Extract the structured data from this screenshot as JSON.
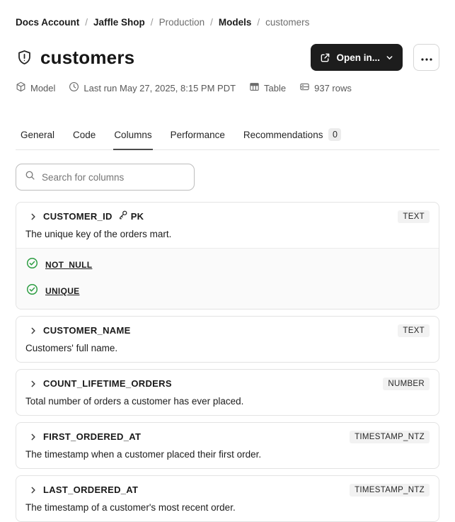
{
  "breadcrumb": {
    "separator": "/",
    "items": [
      {
        "label": "Docs Account",
        "emphasis": true
      },
      {
        "label": "Jaffle Shop",
        "emphasis": true
      },
      {
        "label": "Production",
        "emphasis": false
      },
      {
        "label": "Models",
        "emphasis": true
      },
      {
        "label": "customers",
        "emphasis": false
      }
    ]
  },
  "header": {
    "title": "customers",
    "open_in_label": "Open in...",
    "icons": [
      "shield-alert-icon",
      "external-link-icon",
      "chevron-down-icon",
      "ellipsis-icon"
    ]
  },
  "meta": {
    "resource_type": "Model",
    "last_run": "Last run May 27, 2025, 8:15 PM PDT",
    "materialization": "Table",
    "row_count": "937 rows"
  },
  "tabs": [
    {
      "label": "General",
      "active": false
    },
    {
      "label": "Code",
      "active": false
    },
    {
      "label": "Columns",
      "active": true
    },
    {
      "label": "Performance",
      "active": false
    },
    {
      "label": "Recommendations",
      "active": false,
      "badge": "0"
    }
  ],
  "search": {
    "placeholder": "Search for columns"
  },
  "columns": [
    {
      "name": "CUSTOMER_ID",
      "pk": "PK",
      "type": "TEXT",
      "description": "The unique key of the orders mart.",
      "tests": [
        "NOT_NULL",
        "UNIQUE"
      ]
    },
    {
      "name": "CUSTOMER_NAME",
      "type": "TEXT",
      "description": "Customers' full name.",
      "tests": []
    },
    {
      "name": "COUNT_LIFETIME_ORDERS",
      "type": "NUMBER",
      "description": "Total number of orders a customer has ever placed.",
      "tests": []
    },
    {
      "name": "FIRST_ORDERED_AT",
      "type": "TIMESTAMP_NTZ",
      "description": "The timestamp when a customer placed their first order.",
      "tests": []
    },
    {
      "name": "LAST_ORDERED_AT",
      "type": "TIMESTAMP_NTZ",
      "description": "The timestamp of a customer's most recent order.",
      "tests": []
    }
  ],
  "colors": {
    "button_dark": "#1d1d1d",
    "test_pass_green": "#2f9e44",
    "badge_bg": "#f2f2f2",
    "tab_underline": "#4c4c4c",
    "card_border": "#e3e3e3",
    "tests_bg": "#fafafa"
  }
}
